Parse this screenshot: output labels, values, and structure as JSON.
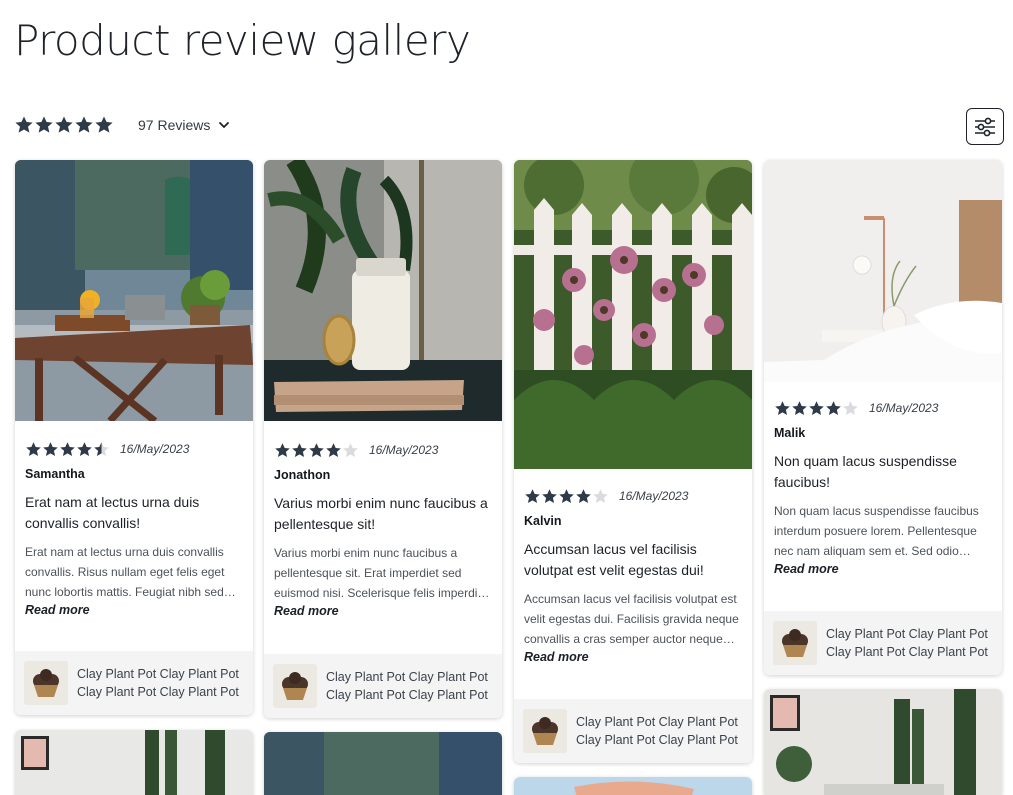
{
  "page": {
    "title": "Product review gallery"
  },
  "summary": {
    "rating": 5,
    "count_label": "97 Reviews"
  },
  "colors": {
    "star": "#2e3a47",
    "star_empty": "#d9dbde"
  },
  "reviews": [
    {
      "rating": 4.5,
      "date": "16/May/2023",
      "author": "Samantha",
      "headline": "Erat nam at lectus urna duis convallis convallis!",
      "snippet": "Erat nam at lectus urna duis convallis convallis. Risus nullam eget felis eget nunc lobortis mattis. Feugiat nibh sed pulvinar proin gravida hendrerit.",
      "read_more": "Read more",
      "product": "Clay Plant Pot Clay Plant Pot Clay Plant Pot Clay Plant Pot"
    },
    {
      "rating": 4,
      "date": "16/May/2023",
      "author": "Jonathon",
      "headline": "Varius morbi enim nunc faucibus a pellentesque sit!",
      "snippet": "Varius morbi enim nunc faucibus a pellentesque sit. Erat imperdiet sed euismod nisi. Scelerisque felis imperdiet proin fermentum leo vel orci.",
      "read_more": "Read more",
      "product": "Clay Plant Pot Clay Plant Pot Clay Plant Pot Clay Plant Pot"
    },
    {
      "rating": 4,
      "date": "16/May/2023",
      "author": "Kalvin",
      "headline": "Accumsan lacus vel facilisis volutpat est velit egestas dui!",
      "snippet": "Accumsan lacus vel facilisis volutpat est velit egestas dui. Facilisis gravida neque convallis a cras semper auctor neque vitae tempus.",
      "read_more": "Read more",
      "product": "Clay Plant Pot Clay Plant Pot Clay Plant Pot Clay Plant Pot"
    },
    {
      "rating": 4,
      "date": "16/May/2023",
      "author": "Malik",
      "headline": "Non quam lacus suspendisse faucibus!",
      "snippet": "Non quam lacus suspendisse faucibus interdum posuere lorem. Pellentesque nec nam aliquam sem et. Sed odio morbi quis commodo odio aenean sed.",
      "read_more": "Read more",
      "product": "Clay Plant Pot Clay Plant Pot Clay Plant Pot Clay Plant Pot"
    }
  ]
}
